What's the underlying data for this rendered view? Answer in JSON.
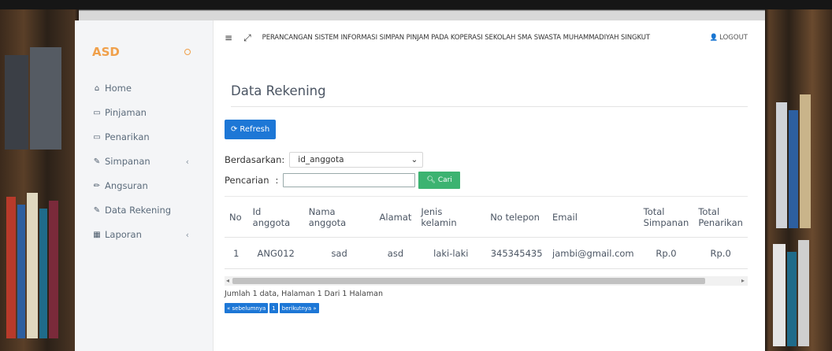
{
  "sidebar": {
    "brand": "ASD",
    "items": [
      {
        "label": "Home",
        "icon": "home-icon",
        "caret": false
      },
      {
        "label": "Pinjaman",
        "icon": "card-icon",
        "caret": false
      },
      {
        "label": "Penarikan",
        "icon": "card-icon",
        "caret": false
      },
      {
        "label": "Simpanan",
        "icon": "edit-icon",
        "caret": true
      },
      {
        "label": "Angsuran",
        "icon": "pencil-icon",
        "caret": false
      },
      {
        "label": "Data Rekening",
        "icon": "edit-icon",
        "caret": false
      },
      {
        "label": "Laporan",
        "icon": "calendar-icon",
        "caret": true
      }
    ]
  },
  "header": {
    "title": "PERANCANGAN SISTEM INFORMASI SIMPAN PINJAM PADA KOPERASI SEKOLAH SMA SWASTA MUHAMMADIYAH SINGKUT",
    "logout": "LOGOUT"
  },
  "page": {
    "title": "Data Rekening",
    "refresh_label": "Refresh",
    "filter_label": "Berdasarkan:",
    "filter_value": "id_anggota",
    "search_label": "Pencarian",
    "search_value": "",
    "search_button": "Cari"
  },
  "table": {
    "columns": [
      "No",
      "Id anggota",
      "Nama anggota",
      "Alamat",
      "Jenis kelamin",
      "No telepon",
      "Email",
      "Total Simpanan",
      "Total Penarikan"
    ],
    "rows": [
      [
        "1",
        "ANG012",
        "sad",
        "asd",
        "laki-laki",
        "345345435",
        "jambi@gmail.com",
        "Rp.0",
        "Rp.0"
      ]
    ]
  },
  "footer": {
    "summary": "Jumlah 1 data, Halaman 1 Dari 1 Halaman",
    "prev": "« sebelumnya",
    "page": "1",
    "next": "berikutnya »"
  },
  "colors": {
    "brand": "#f0a04b",
    "primary": "#1d77d6",
    "success": "#3cb371"
  }
}
